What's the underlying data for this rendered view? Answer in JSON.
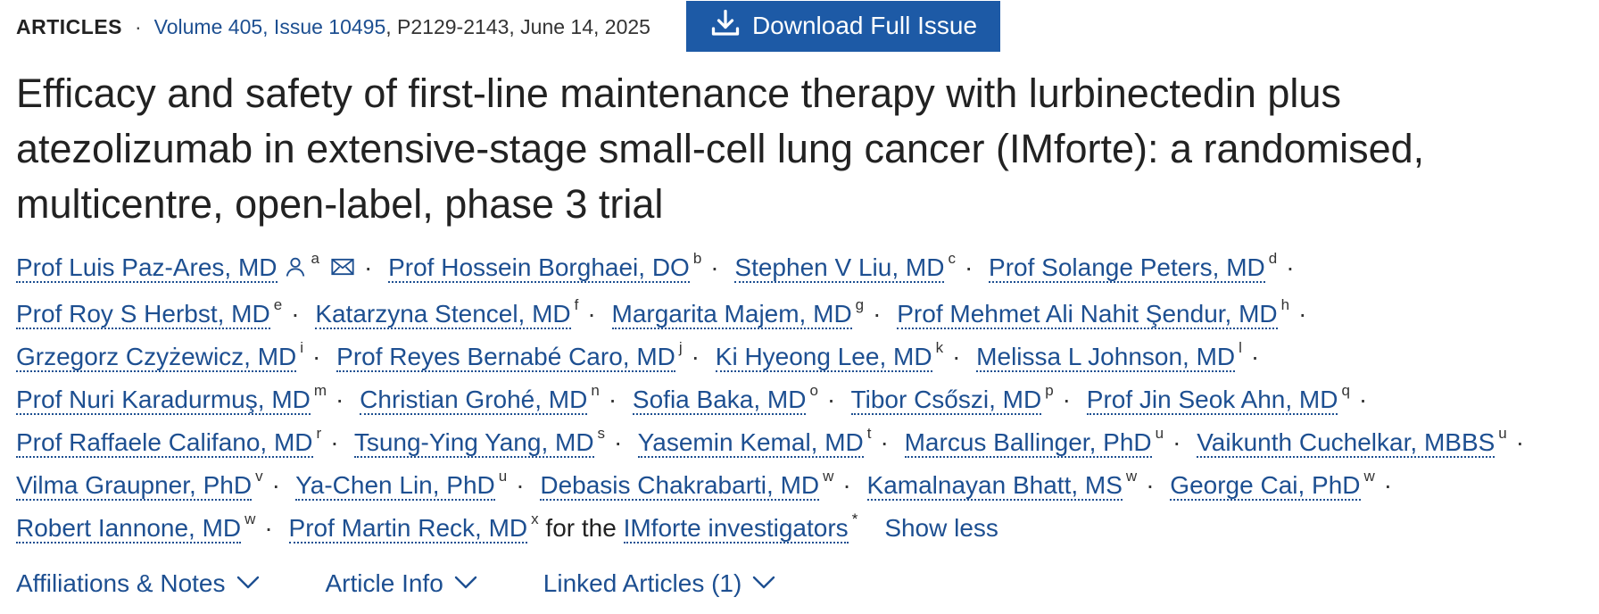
{
  "header": {
    "section": "ARTICLES",
    "separator": "·",
    "volume_link": "Volume 405, Issue 10495",
    "pages_date": ", P2129-2143, June 14, 2025",
    "download_button": "Download Full Issue"
  },
  "title": "Efficacy and safety of first-line maintenance therapy with lurbinectedin plus atezolizumab in extensive-stage small-cell lung cancer (IMforte): a randomised, multicentre, open-label, phase 3 trial",
  "authors": [
    {
      "name": "Prof Luis Paz-Ares, MD",
      "sup": "a"
    },
    {
      "name": "Prof Hossein Borghaei, DO",
      "sup": "b"
    },
    {
      "name": "Stephen V Liu, MD",
      "sup": "c"
    },
    {
      "name": "Prof Solange Peters, MD",
      "sup": "d"
    },
    {
      "name": "Prof Roy S Herbst, MD",
      "sup": "e"
    },
    {
      "name": "Katarzyna Stencel, MD",
      "sup": "f"
    },
    {
      "name": "Margarita Majem, MD",
      "sup": "g"
    },
    {
      "name": "Prof Mehmet Ali Nahit Şendur, MD",
      "sup": "h"
    },
    {
      "name": "Grzegorz Czyżewicz, MD",
      "sup": "i"
    },
    {
      "name": "Prof Reyes Bernabé Caro, MD",
      "sup": "j"
    },
    {
      "name": "Ki Hyeong Lee, MD",
      "sup": "k"
    },
    {
      "name": "Melissa L Johnson, MD",
      "sup": "l"
    },
    {
      "name": "Prof Nuri Karadurmuş, MD",
      "sup": "m"
    },
    {
      "name": "Christian Grohé, MD",
      "sup": "n"
    },
    {
      "name": "Sofia Baka, MD",
      "sup": "o"
    },
    {
      "name": "Tibor Csőszi, MD",
      "sup": "p"
    },
    {
      "name": "Prof Jin Seok Ahn, MD",
      "sup": "q"
    },
    {
      "name": "Prof Raffaele Califano, MD",
      "sup": "r"
    },
    {
      "name": "Tsung-Ying Yang, MD",
      "sup": "s"
    },
    {
      "name": "Yasemin Kemal, MD",
      "sup": "t"
    },
    {
      "name": "Marcus Ballinger, PhD",
      "sup": "u"
    },
    {
      "name": "Vaikunth Cuchelkar, MBBS",
      "sup": "u"
    },
    {
      "name": "Vilma Graupner, PhD",
      "sup": "v"
    },
    {
      "name": "Ya-Chen Lin, PhD",
      "sup": "u"
    },
    {
      "name": "Debasis Chakrabarti, MD",
      "sup": "w"
    },
    {
      "name": "Kamalnayan Bhatt, MS",
      "sup": "w"
    },
    {
      "name": "George Cai, PhD",
      "sup": "w"
    },
    {
      "name": "Robert Iannone, MD",
      "sup": "w"
    },
    {
      "name": "Prof Martin Reck, MD",
      "sup": "x"
    }
  ],
  "for_text": "for the",
  "investigators": {
    "name": "IMforte investigators",
    "sup": "*"
  },
  "show_less": "Show less",
  "tabs": [
    "Affiliations & Notes",
    "Article Info",
    "Linked Articles (1)"
  ],
  "icons": {
    "download": "download-icon",
    "person": "person-icon",
    "mail": "mail-icon",
    "chevron": "chevron-down-icon"
  },
  "colors": {
    "link": "#1d4f91",
    "button": "#1d5aa6"
  }
}
